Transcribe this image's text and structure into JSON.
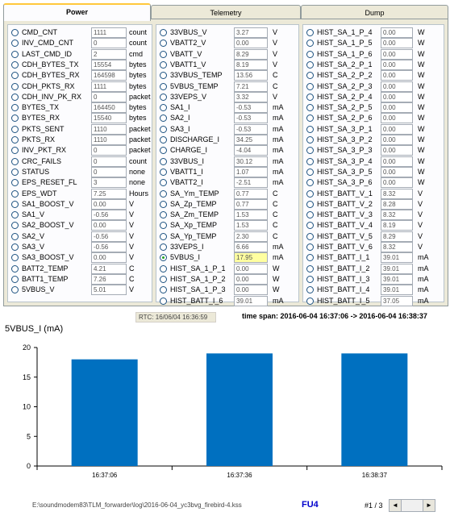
{
  "tabs": [
    {
      "label": "Power",
      "active": true
    },
    {
      "label": "Telemetry",
      "active": false
    },
    {
      "label": "Dump",
      "active": false
    }
  ],
  "col1": [
    {
      "label": "CMD_CNT",
      "value": "1111",
      "unit": "count"
    },
    {
      "label": "INV_CMD_CNT",
      "value": "0",
      "unit": "count"
    },
    {
      "label": "LAST_CMD_ID",
      "value": "2",
      "unit": "cmd"
    },
    {
      "label": "CDH_BYTES_TX",
      "value": "15554",
      "unit": "bytes"
    },
    {
      "label": "CDH_BYTES_RX",
      "value": "164598",
      "unit": "bytes"
    },
    {
      "label": "CDH_PKTS_RX",
      "value": "1111",
      "unit": "bytes"
    },
    {
      "label": "CDH_INV_PK_RX",
      "value": "0",
      "unit": "packet"
    },
    {
      "label": "BYTES_TX",
      "value": "164450",
      "unit": "bytes"
    },
    {
      "label": "BYTES_RX",
      "value": "15540",
      "unit": "bytes"
    },
    {
      "label": "PKTS_SENT",
      "value": "1110",
      "unit": "packet"
    },
    {
      "label": "PKTS_RX",
      "value": "1110",
      "unit": "packet"
    },
    {
      "label": "INV_PKT_RX",
      "value": "0",
      "unit": "packet"
    },
    {
      "label": "CRC_FAILS",
      "value": "0",
      "unit": "count"
    },
    {
      "label": "STATUS",
      "value": "0",
      "unit": "none"
    },
    {
      "label": "EPS_RESET_FL",
      "value": "3",
      "unit": "none"
    },
    {
      "label": "EPS_WDT",
      "value": "7.25",
      "unit": "Hours"
    },
    {
      "label": "SA1_BOOST_V",
      "value": "0.00",
      "unit": "V"
    },
    {
      "label": "SA1_V",
      "value": "-0.56",
      "unit": "V"
    },
    {
      "label": "SA2_BOOST_V",
      "value": "0.00",
      "unit": "V"
    },
    {
      "label": "SA2_V",
      "value": "-0.56",
      "unit": "V"
    },
    {
      "label": "SA3_V",
      "value": "-0.56",
      "unit": "V"
    },
    {
      "label": "SA3_BOOST_V",
      "value": "0.00",
      "unit": "V"
    },
    {
      "label": "BATT2_TEMP",
      "value": "4.21",
      "unit": "C"
    },
    {
      "label": "BATT1_TEMP",
      "value": "7.26",
      "unit": "C"
    },
    {
      "label": "5VBUS_V",
      "value": "5.01",
      "unit": "V"
    }
  ],
  "col2": [
    {
      "label": "33VBUS_V",
      "value": "3.27",
      "unit": "V"
    },
    {
      "label": "VBATT2_V",
      "value": "0.00",
      "unit": "V"
    },
    {
      "label": "VBATT_V",
      "value": "8.29",
      "unit": "V"
    },
    {
      "label": "VBATT1_V",
      "value": "8.19",
      "unit": "V"
    },
    {
      "label": "33VBUS_TEMP",
      "value": "13.56",
      "unit": "C"
    },
    {
      "label": "5VBUS_TEMP",
      "value": "7.21",
      "unit": "C"
    },
    {
      "label": "33VEPS_V",
      "value": "3.32",
      "unit": "V"
    },
    {
      "label": "SA1_I",
      "value": "-0.53",
      "unit": "mA"
    },
    {
      "label": "SA2_I",
      "value": "-0.53",
      "unit": "mA"
    },
    {
      "label": "SA3_I",
      "value": "-0.53",
      "unit": "mA"
    },
    {
      "label": "DISCHARGE_I",
      "value": "34.25",
      "unit": "mA"
    },
    {
      "label": "CHARGE_I",
      "value": "-4.04",
      "unit": "mA"
    },
    {
      "label": "33VBUS_I",
      "value": "30.12",
      "unit": "mA"
    },
    {
      "label": "VBATT1_I",
      "value": "1.07",
      "unit": "mA"
    },
    {
      "label": "VBATT2_I",
      "value": "-2.51",
      "unit": "mA"
    },
    {
      "label": "SA_Ym_TEMP",
      "value": "0.77",
      "unit": "C"
    },
    {
      "label": "SA_Zp_TEMP",
      "value": "0.77",
      "unit": "C"
    },
    {
      "label": "SA_Zm_TEMP",
      "value": "1.53",
      "unit": "C"
    },
    {
      "label": "SA_Xp_TEMP",
      "value": "1.53",
      "unit": "C"
    },
    {
      "label": "SA_Yp_TEMP",
      "value": "2.30",
      "unit": "C"
    },
    {
      "label": "33VEPS_I",
      "value": "6.66",
      "unit": "mA"
    },
    {
      "label": "5VBUS_I",
      "value": "17.95",
      "unit": "mA",
      "selected": true,
      "highlight": true
    },
    {
      "label": "HIST_SA_1_P_1",
      "value": "0.00",
      "unit": "W"
    },
    {
      "label": "HIST_SA_1_P_2",
      "value": "0.00",
      "unit": "W"
    },
    {
      "label": "HIST_SA_1_P_3",
      "value": "0.00",
      "unit": "W"
    },
    {
      "label": "HIST_BATT_I_6",
      "value": "39.01",
      "unit": "mA"
    }
  ],
  "col3": [
    {
      "label": "HIST_SA_1_P_4",
      "value": "0.00",
      "unit": "W"
    },
    {
      "label": "HIST_SA_1_P_5",
      "value": "0.00",
      "unit": "W"
    },
    {
      "label": "HIST_SA_1_P_6",
      "value": "0.00",
      "unit": "W"
    },
    {
      "label": "HIST_SA_2_P_1",
      "value": "0.00",
      "unit": "W"
    },
    {
      "label": "HIST_SA_2_P_2",
      "value": "0.00",
      "unit": "W"
    },
    {
      "label": "HIST_SA_2_P_3",
      "value": "0.00",
      "unit": "W"
    },
    {
      "label": "HIST_SA_2_P_4",
      "value": "0.00",
      "unit": "W"
    },
    {
      "label": "HIST_SA_2_P_5",
      "value": "0.00",
      "unit": "W"
    },
    {
      "label": "HIST_SA_2_P_6",
      "value": "0.00",
      "unit": "W"
    },
    {
      "label": "HIST_SA_3_P_1",
      "value": "0.00",
      "unit": "W"
    },
    {
      "label": "HIST_SA_3_P_2",
      "value": "0.00",
      "unit": "W"
    },
    {
      "label": "HIST_SA_3_P_3",
      "value": "0.00",
      "unit": "W"
    },
    {
      "label": "HIST_SA_3_P_4",
      "value": "0.00",
      "unit": "W"
    },
    {
      "label": "HIST_SA_3_P_5",
      "value": "0.00",
      "unit": "W"
    },
    {
      "label": "HIST_SA_3_P_6",
      "value": "0.00",
      "unit": "W"
    },
    {
      "label": "HIST_BATT_V_1",
      "value": "8.32",
      "unit": "V"
    },
    {
      "label": "HIST_BATT_V_2",
      "value": "8.28",
      "unit": "V"
    },
    {
      "label": "HIST_BATT_V_3",
      "value": "8.32",
      "unit": "V"
    },
    {
      "label": "HIST_BATT_V_4",
      "value": "8.19",
      "unit": "V"
    },
    {
      "label": "HIST_BATT_V_5",
      "value": "8.29",
      "unit": "V"
    },
    {
      "label": "HIST_BATT_V_6",
      "value": "8.32",
      "unit": "V"
    },
    {
      "label": "HIST_BATT_I_1",
      "value": "39.01",
      "unit": "mA"
    },
    {
      "label": "HIST_BATT_I_2",
      "value": "39.01",
      "unit": "mA"
    },
    {
      "label": "HIST_BATT_I_3",
      "value": "39.01",
      "unit": "mA"
    },
    {
      "label": "HIST_BATT_I_4",
      "value": "39.01",
      "unit": "mA"
    },
    {
      "label": "HIST_BATT_I_5",
      "value": "37.05",
      "unit": "mA"
    }
  ],
  "status": {
    "rtc": "RTC: 16/06/04 16:36:59",
    "time_span_label": "time span:",
    "time_span_value": "2016-06-04 16:37:06 -> 2016-06-04 16:38:37"
  },
  "chart_data": {
    "type": "bar",
    "title": "5VBUS_I (mA)",
    "categories": [
      "16:37:06",
      "16:37:36",
      "16:38:37"
    ],
    "values": [
      18,
      19,
      19
    ],
    "ylim": [
      0,
      20
    ],
    "yticks": [
      0,
      5,
      10,
      15,
      20
    ],
    "grid": false,
    "bar_color": "#0070c0"
  },
  "footer": {
    "file_path": "E:\\soundmodem83\\TLM_forwarder\\log\\2016-06-04_yc3bvg_firebird-4.kss",
    "fu_label": "FU4",
    "page_indicator": "#1 / 3",
    "prev_icon": "◄",
    "next_icon": "►"
  },
  "colors": {
    "panel_bg": "#ece9d8",
    "accent_tab": "#ffc83c",
    "highlight_value": "#ffffa0",
    "fu_text": "#0000cc"
  }
}
